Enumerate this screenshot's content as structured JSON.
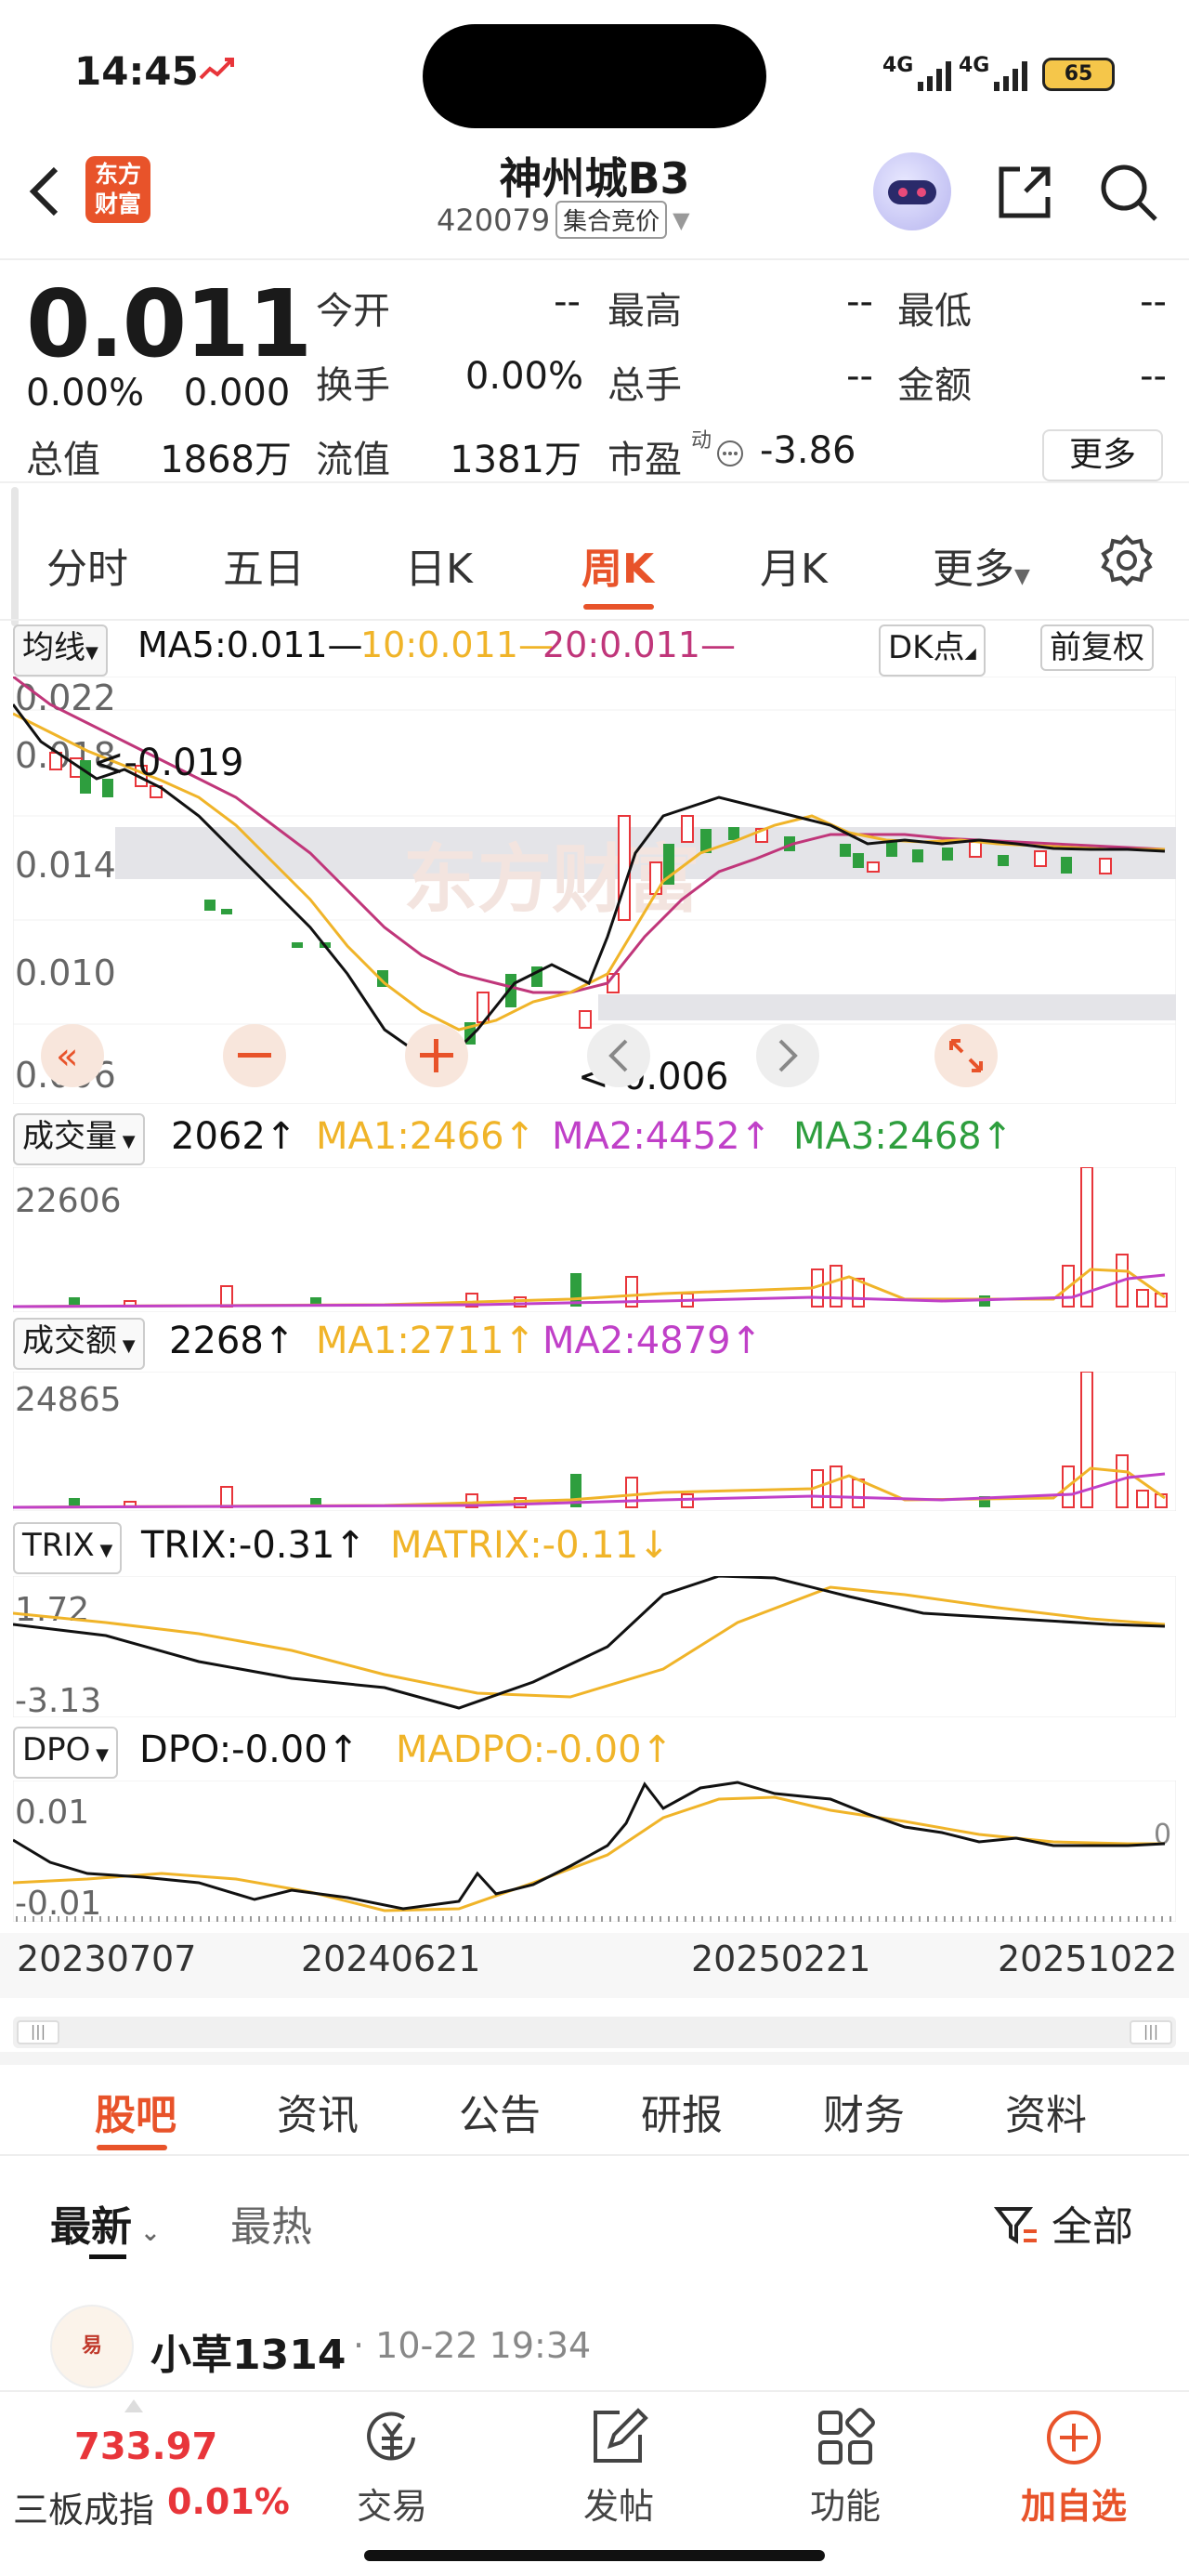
{
  "status": {
    "time": "14:45",
    "signal1": "4G",
    "signal2": "4G",
    "battery": "65"
  },
  "header": {
    "logo_line1": "东方",
    "logo_line2": "财富",
    "title": "神州城B3",
    "code": "420079",
    "market_tag": "集合竞价"
  },
  "quote": {
    "price": "0.011",
    "change_pct": "0.00%",
    "change_abs": "0.000",
    "labels": {
      "open": "今开",
      "high": "最高",
      "low": "最低",
      "turnover": "换手",
      "volume": "总手",
      "amount": "金额",
      "total_value": "总值",
      "float_value": "流值",
      "pe": "市盈",
      "pe_sup": "动"
    },
    "values": {
      "open": "--",
      "high": "--",
      "low": "--",
      "turnover": "0.00%",
      "volume": "--",
      "amount": "--",
      "total_value": "1868万",
      "float_value": "1381万",
      "pe": "-3.86"
    },
    "more_button": "更多"
  },
  "chart_tabs": {
    "items": [
      "分时",
      "五日",
      "日K",
      "周K",
      "月K",
      "更多"
    ],
    "active": "周K"
  },
  "ma_header": {
    "selector": "均线",
    "ma5": "MA5:0.011—",
    "ma10": "10:0.011—",
    "ma20": "20:0.011—",
    "dk": "DK点",
    "adjust": "前复权"
  },
  "main_chart": {
    "y_labels": [
      "0.022",
      "0.018",
      "0.014",
      "0.010",
      "0.006"
    ],
    "high_marker": "<-0.019",
    "low_marker": "<-0.006",
    "watermark": "东方财富"
  },
  "volume": {
    "selector": "成交量",
    "value": "2062",
    "ma1": "MA1:2466",
    "ma2": "MA2:4452",
    "ma3": "MA3:2468",
    "max_label": "22606"
  },
  "amount": {
    "selector": "成交额",
    "value": "2268",
    "ma1": "MA1:2711",
    "ma2": "MA2:4879",
    "max_label": "24865"
  },
  "trix": {
    "selector": "TRIX",
    "value": "TRIX:-0.31",
    "matrix": "MATRIX:-0.11",
    "top_label": "1.72",
    "bottom_label": "-3.13"
  },
  "dpo": {
    "selector": "DPO",
    "value": "DPO:-0.00",
    "madpo": "MADPO:-0.00",
    "top_label": "0.01",
    "bottom_label": "-0.01",
    "zero_label": "0"
  },
  "x_axis": [
    "20230707",
    "20240621",
    "20250221",
    "20251022"
  ],
  "section_tabs": {
    "items": [
      "股吧",
      "资讯",
      "公告",
      "研报",
      "财务",
      "资料"
    ],
    "active": "股吧"
  },
  "sub_tabs": {
    "latest": "最新",
    "hot": "最热",
    "filter": "全部"
  },
  "post": {
    "user": "小草1314",
    "time": "· 10-22 19:34"
  },
  "bottom_nav": {
    "index_value": "733.97",
    "index_name": "三板成指",
    "index_change": "0.01%",
    "trade": "交易",
    "post": "发帖",
    "function": "功能",
    "add": "加自选"
  },
  "colors": {
    "accent": "#e8532a",
    "up": "#e8353a",
    "down": "#2e9e3e",
    "ma10": "#f0b429",
    "ma20": "#c0367a"
  }
}
